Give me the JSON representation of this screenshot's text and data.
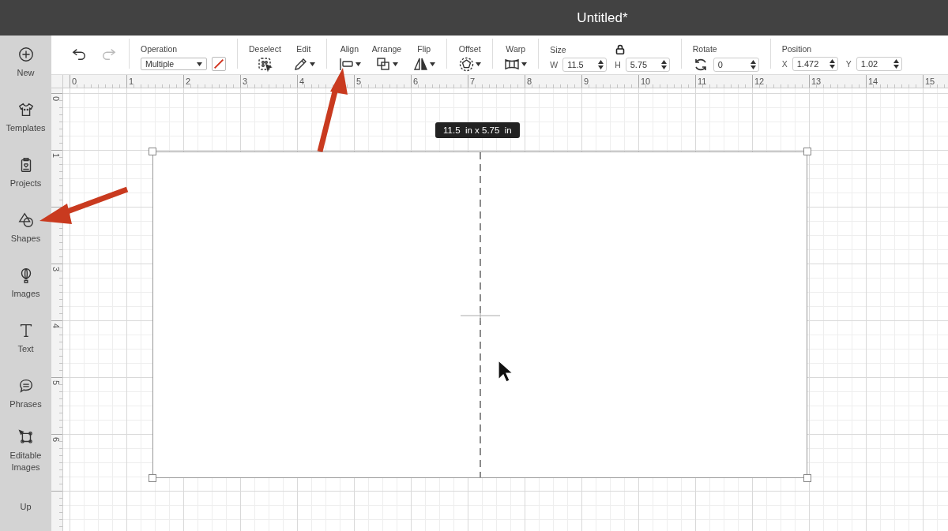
{
  "window": {
    "title": "Untitled*"
  },
  "sidebar": {
    "items": [
      {
        "label": "New",
        "kind": "new"
      },
      {
        "label": "Templates",
        "kind": "templates"
      },
      {
        "label": "Projects",
        "kind": "projects"
      },
      {
        "label": "Shapes",
        "kind": "shapes"
      },
      {
        "label": "Images",
        "kind": "images"
      },
      {
        "label": "Text",
        "kind": "text"
      },
      {
        "label": "Phrases",
        "kind": "phrases"
      },
      {
        "label": "Editable Images",
        "kind": "editable"
      },
      {
        "label": "Up",
        "kind": "none"
      }
    ]
  },
  "toolbar": {
    "history": [
      {
        "kind": "undo",
        "disabled": false
      },
      {
        "kind": "redo",
        "disabled": true
      }
    ],
    "operation": {
      "label": "Operation",
      "value": "Multiple"
    },
    "tool_groups": [
      [
        {
          "label": "Deselect",
          "kind": "deselect",
          "dropdown": false
        },
        {
          "label": "Edit",
          "kind": "pen",
          "dropdown": true
        }
      ],
      [
        {
          "label": "Align",
          "kind": "align",
          "dropdown": true
        },
        {
          "label": "Arrange",
          "kind": "arrange",
          "dropdown": true
        },
        {
          "label": "Flip",
          "kind": "flip",
          "dropdown": true
        }
      ],
      [
        {
          "label": "Offset",
          "kind": "offset",
          "dropdown": true
        }
      ],
      [
        {
          "label": "Warp",
          "kind": "warp",
          "dropdown": true
        }
      ]
    ],
    "size": {
      "label": "Size",
      "locked": true,
      "fields": [
        {
          "prefix": "W",
          "value": "11.5"
        },
        {
          "prefix": "H",
          "value": "5.75"
        }
      ]
    },
    "rotate": {
      "label": "Rotate",
      "value": "0"
    },
    "position": {
      "label": "Position",
      "fields": [
        {
          "prefix": "X",
          "value": "1.472"
        },
        {
          "prefix": "Y",
          "value": "1.02"
        }
      ]
    }
  },
  "rulers": {
    "horizontal": [
      "0",
      "1",
      "2",
      "3",
      "4",
      "5",
      "6",
      "7",
      "8",
      "9",
      "10",
      "11",
      "12",
      "13",
      "14",
      "15"
    ],
    "vertical": [
      {
        "label": "0"
      },
      {
        "label": "1"
      },
      {
        "label": "3",
        "gap_before": true
      },
      {
        "label": "4"
      },
      {
        "label": "5"
      },
      {
        "label": "6"
      }
    ]
  },
  "canvas": {
    "tooltip": "11.5  in x 5.75  in"
  }
}
